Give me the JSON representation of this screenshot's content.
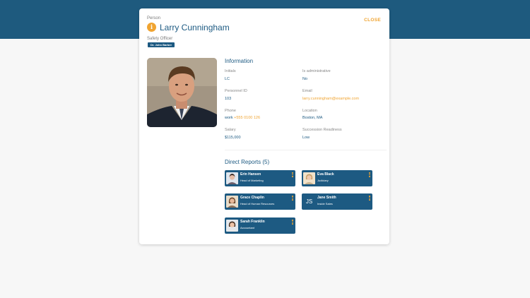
{
  "person": {
    "type_label": "Person",
    "info_badge": "i",
    "name": "Larry Cunningham",
    "role": "Safety Officer",
    "manager": "Dr. John Barber"
  },
  "header": {
    "close_label": "CLOSE"
  },
  "information": {
    "title": "Information",
    "fields": {
      "initials": {
        "label": "Initials",
        "value": "LC"
      },
      "is_admin": {
        "label": "Is administrative",
        "value": "No"
      },
      "personnel_id": {
        "label": "Personnel ID",
        "value": "103"
      },
      "email": {
        "label": "Email",
        "value": "larry.cunningham@example.com"
      },
      "phone": {
        "label": "Phone",
        "prefix": "work",
        "value": "+555 0100 126"
      },
      "location": {
        "label": "Location",
        "value": "Boston, MA"
      },
      "salary": {
        "label": "Salary",
        "value": "$115,000"
      },
      "succession": {
        "label": "Succession Readiness",
        "value": "Low"
      }
    }
  },
  "direct_reports": {
    "title": "Direct Reports (5)",
    "items": [
      {
        "name": "Erin Hansen",
        "title": "Head of Marketing"
      },
      {
        "name": "Eva Black",
        "title": "Judiciary"
      },
      {
        "name": "Grace Chaplin",
        "title": "Head of Human Resources"
      },
      {
        "name": "Jane Smith",
        "title": "Inside Sales",
        "initials": "JS"
      },
      {
        "name": "Sarah Franklin",
        "title": "Accountant"
      }
    ]
  },
  "colors": {
    "brand": "#1d5a82",
    "accent": "#f0a431",
    "band": "#1e5a7e"
  }
}
